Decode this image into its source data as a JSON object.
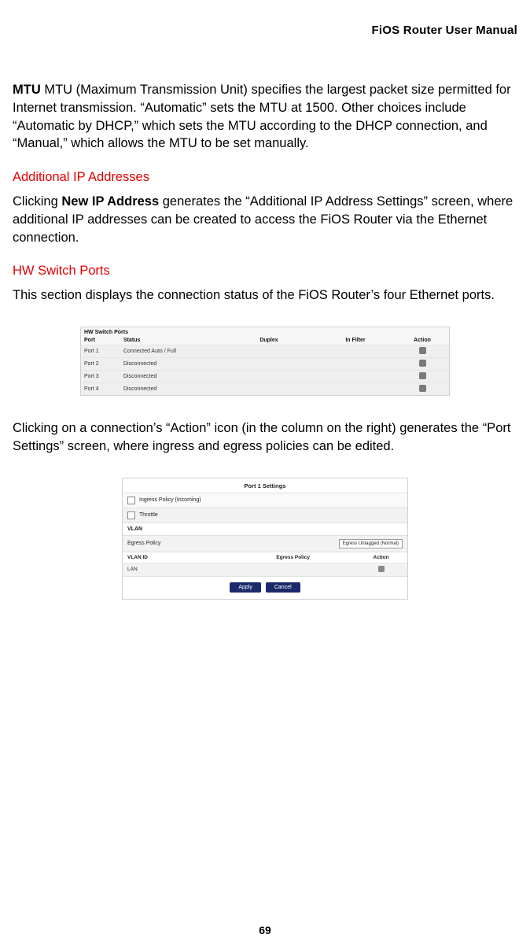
{
  "header": {
    "title": "FiOS Router User Manual"
  },
  "mtu": {
    "label": "MTU",
    "body": "  MTU (Maximum Transmission Unit) specifies the largest packet size permitted for Internet transmission. “Automatic” sets the MTU at 1500. Other choices include “Automatic by DHCP,” which sets the MTU according to the DHCP connection, and “Manual,” which allows the MTU to be set manually."
  },
  "additional_ip": {
    "heading": "Additional IP Addresses",
    "lead": "Clicking ",
    "bold": "New IP Address",
    "rest": " generates the “Additional IP Address Settings” screen, where additional IP addresses can be created to access the FiOS Router via the Ethernet connection."
  },
  "hw": {
    "heading": "HW Switch Ports",
    "body": "This section displays the connection status of the FiOS Router’s four Ethernet ports.",
    "table": {
      "title": "HW Switch Ports",
      "headers": {
        "port": "Port",
        "status": "Status",
        "duplex": "Duplex",
        "filter": "In Filter",
        "action": "Action"
      },
      "rows": [
        {
          "port": "Port 1",
          "status": "Connected  Auto / Full"
        },
        {
          "port": "Port 2",
          "status": "Disconnected"
        },
        {
          "port": "Port 3",
          "status": "Disconnected"
        },
        {
          "port": "Port 4",
          "status": "Disconnected"
        }
      ]
    },
    "after": "Clicking on a connection’s “Action” icon (in the column on the right) generates the “Port Settings” screen, where ingress and egress policies can be edited."
  },
  "port_settings": {
    "title": "Port 1 Settings",
    "row1": "Ingress Policy (Incoming)",
    "row2": "Throttle",
    "vlan_label": "VLAN",
    "egress_label": "Egress Policy",
    "egress_value": "Egress Untagged (Normal)",
    "headers": {
      "c1": "VLAN ID",
      "c2": "Egress Policy",
      "c3": "Action"
    },
    "datarow": {
      "c1": "LAN"
    },
    "buttons": {
      "apply": "Apply",
      "cancel": "Cancel"
    }
  },
  "page_number": "69"
}
